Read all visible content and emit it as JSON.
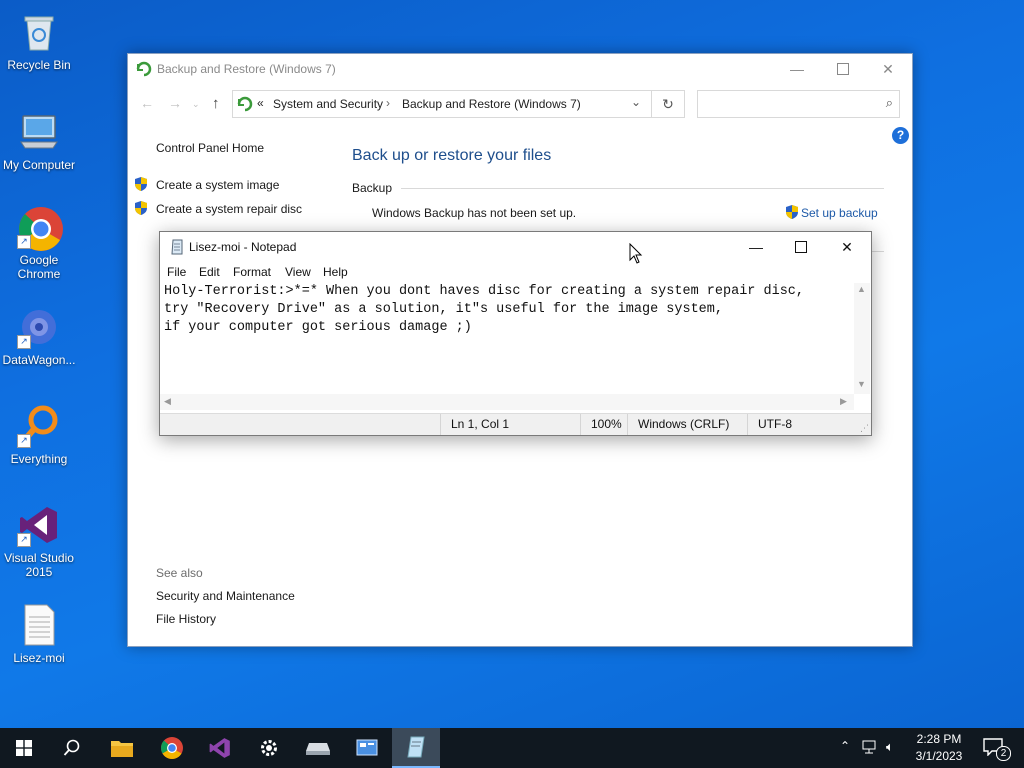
{
  "desktop": {
    "icons": [
      {
        "label": "Recycle Bin"
      },
      {
        "label": "My Computer"
      },
      {
        "label": "Google Chrome"
      },
      {
        "label": "DataWagon..."
      },
      {
        "label": "Everything"
      },
      {
        "label": "Visual Studio 2015"
      },
      {
        "label": "Lisez-moi"
      }
    ]
  },
  "control_panel": {
    "title": "Backup and Restore (Windows 7)",
    "breadcrumb_prefix": "«",
    "breadcrumb_1": "System and Security",
    "breadcrumb_sep": "›",
    "breadcrumb_2": "Backup and Restore (Windows 7)",
    "search_placeholder": "",
    "sidebar": {
      "home": "Control Panel Home",
      "items": [
        {
          "label": "Create a system image"
        },
        {
          "label": "Create a system repair disc"
        }
      ],
      "see_also_heading": "See also",
      "see_also": [
        {
          "label": "Security and Maintenance"
        },
        {
          "label": "File History"
        }
      ]
    },
    "main": {
      "heading": "Back up or restore your files",
      "section_label": "Backup",
      "status_text": "Windows Backup has not been set up.",
      "setup_link": "Set up backup"
    }
  },
  "notepad": {
    "title": "Lisez-moi - Notepad",
    "menu": [
      "File",
      "Edit",
      "Format",
      "View",
      "Help"
    ],
    "content": "Holy-Terrorist:>*=* When you dont haves disc for creating a system repair disc,\ntry \"Recovery Drive\" as a solution, it\"s useful for the image system,\nif your computer got serious damage ;)",
    "status": {
      "position": "Ln 1, Col 1",
      "zoom": "100%",
      "line_ending": "Windows (CRLF)",
      "encoding": "UTF-8"
    }
  },
  "taskbar": {
    "time": "2:28 PM",
    "date": "3/1/2023",
    "notification_count": "2"
  },
  "colors": {
    "desktop_blue": "#0f6fe0",
    "taskbar_bg": "#101820",
    "link_blue": "#1e5aa8",
    "heading_blue": "#1e4e8c"
  }
}
